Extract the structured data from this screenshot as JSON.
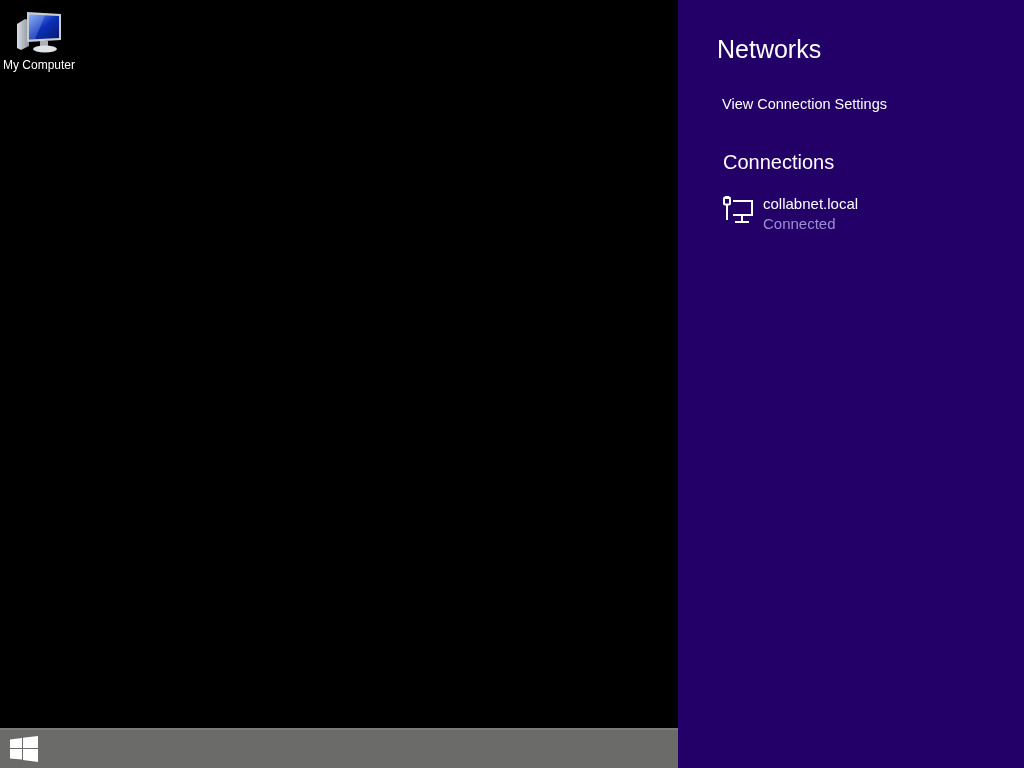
{
  "desktop": {
    "icons": [
      {
        "label": "My Computer"
      }
    ]
  },
  "networks_panel": {
    "title": "Networks",
    "settings_link": "View Connection Settings",
    "section_title": "Connections",
    "connections": [
      {
        "name": "collabnet.local",
        "status": "Connected"
      }
    ]
  }
}
